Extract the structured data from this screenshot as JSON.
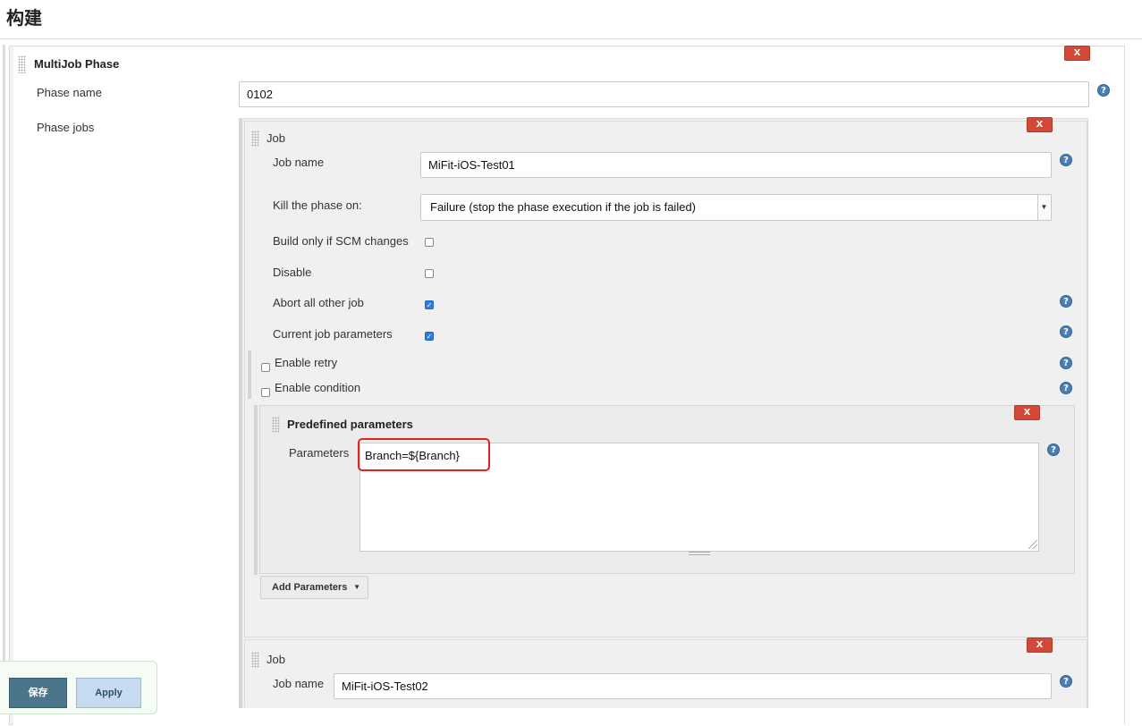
{
  "section_title": "构建",
  "phase": {
    "title": "MultiJob Phase",
    "delete_label": "X",
    "phase_name_label": "Phase name",
    "phase_name_value": "0102",
    "phase_jobs_label": "Phase jobs"
  },
  "help_glyph": "?",
  "jobs": [
    {
      "title": "Job",
      "delete_label": "X",
      "job_name_label": "Job name",
      "job_name_value": "MiFit-iOS-Test01",
      "kill_phase_label": "Kill the phase on:",
      "kill_phase_value": "Failure (stop the phase execution if the job is failed)",
      "build_only_scm_label": "Build only if SCM changes",
      "build_only_scm_checked": false,
      "disable_label": "Disable",
      "disable_checked": false,
      "abort_all_label": "Abort all other job",
      "abort_all_checked": true,
      "current_params_label": "Current job parameters",
      "current_params_checked": true,
      "enable_retry_label": "Enable retry",
      "enable_retry_checked": false,
      "enable_condition_label": "Enable condition",
      "enable_condition_checked": false,
      "predefined": {
        "title": "Predefined parameters",
        "delete_label": "X",
        "parameters_label": "Parameters",
        "parameters_value": "Branch=${Branch}"
      },
      "add_parameters_label": "Add Parameters"
    },
    {
      "title": "Job",
      "delete_label": "X",
      "job_name_label": "Job name",
      "job_name_value": "MiFit-iOS-Test02"
    }
  ],
  "footer": {
    "save_label": "保存",
    "apply_label": "Apply"
  },
  "colors": {
    "delete_button": "#d24939",
    "help_icon": "#4a7fb5",
    "highlight_border": "#e3231e",
    "save_button": "#4b758b",
    "apply_button": "#c6dbf0"
  }
}
